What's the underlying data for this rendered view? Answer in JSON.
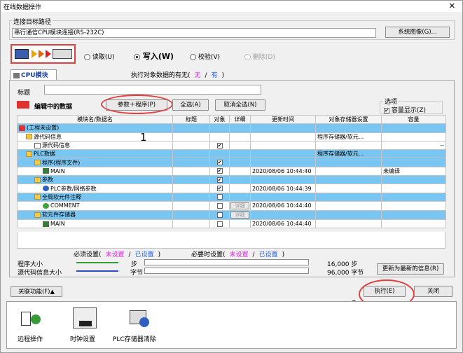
{
  "window": {
    "title": "在线数据操作",
    "close": "✕"
  },
  "conn": {
    "group_label": "连接目标路径",
    "path": "串行通信CPU模块连接(RS-232C)",
    "system_image_btn": "系统图像(G)..."
  },
  "mode": {
    "read": "读取(U)",
    "write": "写入(W)",
    "verify": "校验(V)",
    "delete": "删除(D)"
  },
  "tab": {
    "cpu": "CPU模块",
    "exec_flag_label": "执行对象数据的有无(",
    "none": "无",
    "slash": "/",
    "yes": "有",
    "close_paren": ")"
  },
  "title_label": "标题",
  "edit_data_label": "编辑中的数据",
  "buttons": {
    "param_prog": "参数＋程序(P)",
    "select_all": "全选(A)",
    "deselect_all": "取消全选(N)",
    "update_latest": "更新为最新的信息(R)",
    "execute": "执行(E)",
    "close": "关闭",
    "related": "关联功能(F)▲",
    "detail": "详细"
  },
  "options": {
    "label": "选项",
    "capacity_display": "容量显示(Z)"
  },
  "table": {
    "headers": [
      "模块名/数据名",
      "标题",
      "对象",
      "详细",
      "更新时间",
      "对象存储器设置",
      "容量"
    ],
    "rows": [
      {
        "name": "(工程未设置)",
        "title": "",
        "obj": "",
        "detail": "",
        "time": "",
        "mem": "",
        "cap": ""
      },
      {
        "name": "源代码信息",
        "title": "",
        "obj": "",
        "detail": "",
        "time": "",
        "mem": "程序存储器/软元...",
        "cap": ""
      },
      {
        "name": "源代码信息",
        "title": "",
        "obj": "✔",
        "detail": "",
        "time": "",
        "mem": "",
        "cap": "--"
      },
      {
        "name": "PLC数据",
        "title": "",
        "obj": "",
        "detail": "",
        "time": "",
        "mem": "程序存储器/软元...",
        "cap": ""
      },
      {
        "name": "程序(程序文件)",
        "title": "",
        "obj": "✔",
        "detail": "",
        "time": "",
        "mem": "",
        "cap": ""
      },
      {
        "name": "MAIN",
        "title": "",
        "obj": "✔",
        "detail": "",
        "time": "2020/08/06 10:44:40",
        "mem": "",
        "cap": "未编译"
      },
      {
        "name": "参数",
        "title": "",
        "obj": "✔",
        "detail": "",
        "time": "",
        "mem": "",
        "cap": ""
      },
      {
        "name": "PLC参数/网络参数",
        "title": "",
        "obj": "✔",
        "detail": "",
        "time": "2020/08/06 10:44:39",
        "mem": "",
        "cap": ""
      },
      {
        "name": "全局软元件注释",
        "title": "",
        "obj": "",
        "detail": "",
        "time": "",
        "mem": "",
        "cap": ""
      },
      {
        "name": "COMMENT",
        "title": "",
        "obj": "",
        "detail": "详细",
        "time": "2020/08/06 10:44:40",
        "mem": "",
        "cap": ""
      },
      {
        "name": "软元件存储器",
        "title": "",
        "obj": "",
        "detail": "",
        "time": "",
        "mem": "",
        "cap": ""
      },
      {
        "name": "MAIN",
        "title": "",
        "obj": "",
        "detail": "详细",
        "time": "2020/08/06 10:44:40",
        "mem": "",
        "cap": ""
      }
    ]
  },
  "legend": {
    "required": "必须设置(",
    "unset1": "未设置",
    "sep1": "/",
    "set1": "已设置",
    "close1": ")",
    "when_required": "必要时设置(",
    "unset2": "未设置",
    "sep2": "/",
    "set2": "已设置",
    "close2": ")"
  },
  "sizes": {
    "program_size_label": "程序大小",
    "source_size_label": "源代码信息大小",
    "step_unit": "步",
    "byte_unit": "字节",
    "program_value": "16,000 步",
    "source_value": "96,000 字节"
  },
  "annotations": {
    "one": "1",
    "two": "2"
  },
  "tools": [
    {
      "label": "远程操作"
    },
    {
      "label": "时钟设置"
    },
    {
      "label": "PLC存储器清除"
    }
  ]
}
